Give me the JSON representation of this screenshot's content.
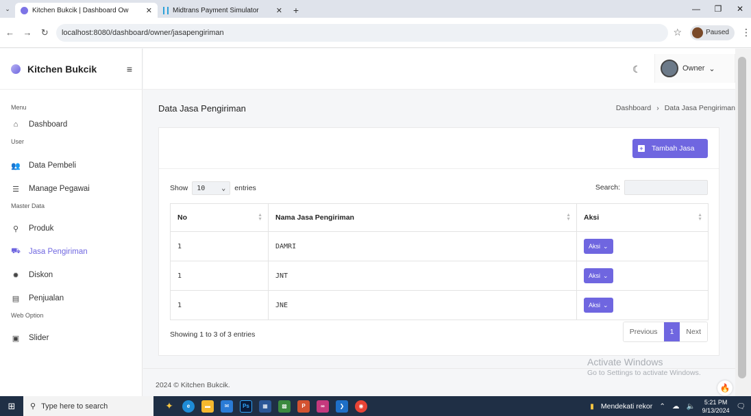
{
  "browser": {
    "tabs": [
      {
        "title": "Kitchen Bukcik | Dashboard Ow",
        "active": true
      },
      {
        "title": "Midtrans Payment Simulator",
        "active": false
      }
    ],
    "url": "localhost:8080/dashboard/owner/jasapengiriman",
    "profile_label": "Paused"
  },
  "sidebar": {
    "brand": "Kitchen Bukcik",
    "sections": [
      {
        "label": "Menu",
        "items": [
          {
            "label": "Dashboard",
            "icon": "home-icon"
          }
        ]
      },
      {
        "label": "User",
        "items": [
          {
            "label": "Data Pembeli",
            "icon": "users-icon"
          },
          {
            "label": "Manage Pegawai",
            "icon": "user-list-icon"
          }
        ]
      },
      {
        "label": "Master Data",
        "items": [
          {
            "label": "Produk",
            "icon": "product-icon"
          },
          {
            "label": "Jasa Pengiriman",
            "icon": "truck-icon",
            "active": true
          },
          {
            "label": "Diskon",
            "icon": "discount-icon"
          },
          {
            "label": "Penjualan",
            "icon": "receipt-icon"
          }
        ]
      },
      {
        "label": "Web Option",
        "items": [
          {
            "label": "Slider",
            "icon": "slider-icon"
          }
        ]
      }
    ]
  },
  "topbar": {
    "user_label": "Owner"
  },
  "page": {
    "title": "Data Jasa Pengiriman",
    "breadcrumb": [
      "Dashboard",
      "Data Jasa Pengiriman"
    ],
    "add_button": "Tambah Jasa",
    "show_label": "Show",
    "entries_value": "10",
    "entries_label": "entries",
    "search_label": "Search:",
    "columns": [
      "No",
      "Nama Jasa Pengiriman",
      "Aksi"
    ],
    "rows": [
      {
        "no": "1",
        "name": "DAMRI",
        "action": "Aksi"
      },
      {
        "no": "1",
        "name": "JNT",
        "action": "Aksi"
      },
      {
        "no": "1",
        "name": "JNE",
        "action": "Aksi"
      }
    ],
    "info": "Showing 1 to 3 of 3 entries",
    "pager": {
      "prev": "Previous",
      "current": "1",
      "next": "Next"
    },
    "footer": "2024 © Kitchen Bukcik.",
    "watermark": {
      "title": "Activate Windows",
      "subtitle": "Go to Settings to activate Windows."
    }
  },
  "taskbar": {
    "search_placeholder": "Type here to search",
    "notification": "Mendekati rekor",
    "time": "5:21 PM",
    "date": "9/13/2024"
  },
  "colors": {
    "accent": "#6f66e0"
  }
}
